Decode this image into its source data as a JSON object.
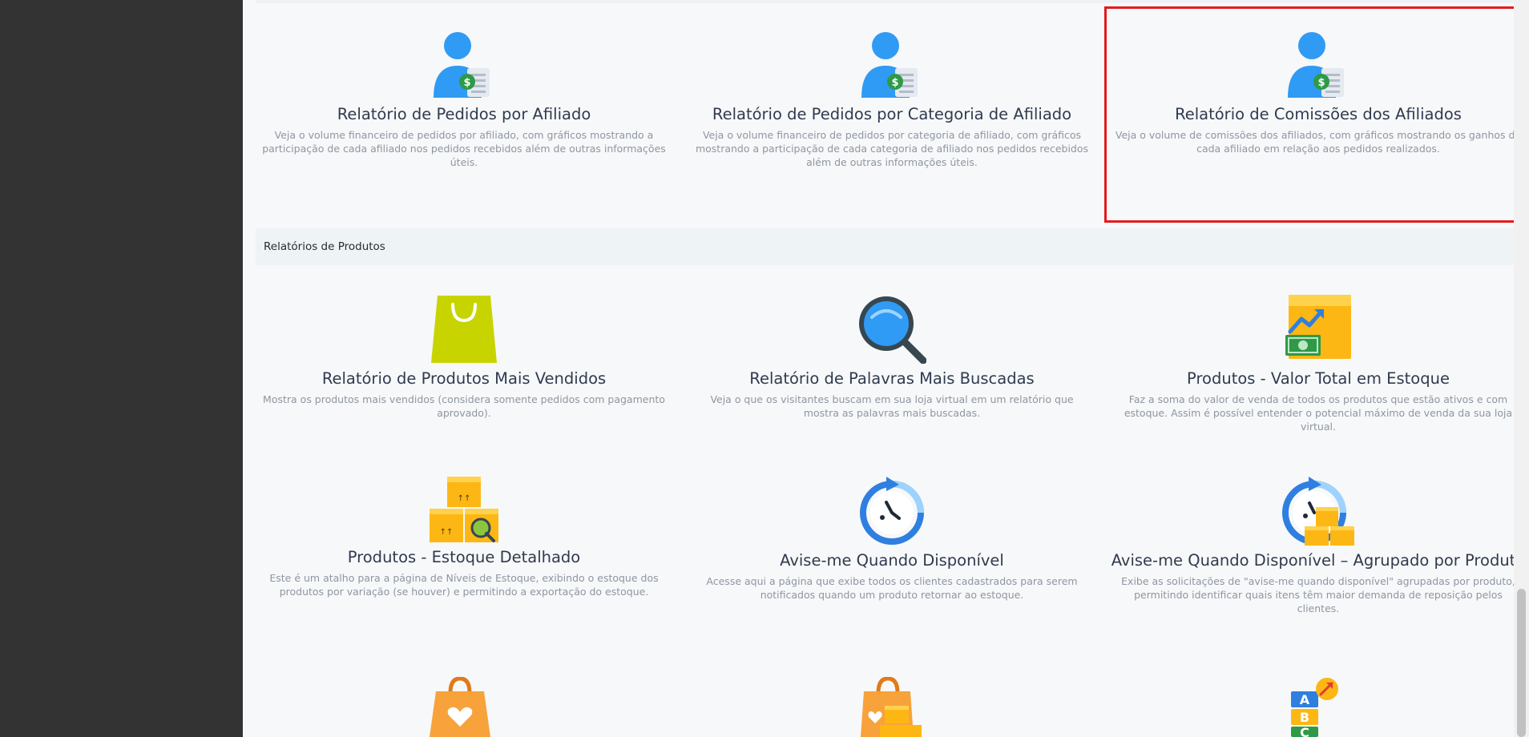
{
  "affiliate_reports": [
    {
      "title": "Relatório de Pedidos por Afiliado",
      "desc": "Veja o volume financeiro de pedidos por afiliado, com gráficos mostrando a participação de cada afiliado nos pedidos recebidos além de outras informações úteis.",
      "icon": "affiliate-money-icon"
    },
    {
      "title": "Relatório de Pedidos por Categoria de Afiliado",
      "desc": "Veja o volume financeiro de pedidos por categoria de afiliado, com gráficos mostrando a participação de cada categoria de afiliado nos pedidos recebidos além de outras informações úteis.",
      "icon": "affiliate-money-icon"
    },
    {
      "title": "Relatório de Comissões dos Afiliados",
      "desc": "Veja o volume de comissões dos afiliados, com gráficos mostrando os ganhos de cada afiliado em relação aos pedidos realizados.",
      "icon": "affiliate-money-icon"
    }
  ],
  "products_section": {
    "label": "Relatórios de Produtos"
  },
  "product_reports": [
    {
      "title": "Relatório de Produtos Mais Vendidos",
      "desc": "Mostra os produtos mais vendidos (considera somente pedidos com pagamento aprovado).",
      "icon": "shopping-bag-icon"
    },
    {
      "title": "Relatório de Palavras Mais Buscadas",
      "desc": "Veja o que os visitantes buscam em sua loja virtual em um relatório que mostra as palavras mais buscadas.",
      "icon": "magnifier-icon"
    },
    {
      "title": "Produtos - Valor Total em Estoque",
      "desc": "Faz a soma do valor de venda de todos os produtos que estão ativos e com estoque. Assim é possível entender o potencial máximo de venda da sua loja virtual.",
      "icon": "stock-value-box-icon"
    },
    {
      "title": "Produtos - Estoque Detalhado",
      "desc": "Este é um atalho para a página de Níveis de Estoque, exibindo o estoque dos produtos por variação (se houver) e permitindo a exportação do estoque.",
      "icon": "boxes-search-icon"
    },
    {
      "title": "Avise-me Quando Disponível",
      "desc": "Acesse aqui a página que exibe todos os clientes cadastrados para serem notificados quando um produto retornar ao estoque.",
      "icon": "clock-refresh-icon"
    },
    {
      "title": "Avise-me Quando Disponível – Agrupado por Produto",
      "desc": "Exibe as solicitações de \"avise-me quando disponível\" agrupadas por produto, permitindo identificar quais itens têm maior demanda de reposição pelos clientes.",
      "icon": "clock-boxes-icon"
    }
  ],
  "bottom_icons": [
    "heart-bag-icon",
    "bag-boxes-icon",
    "abc-trend-icon"
  ],
  "colors": {
    "sidebar": "#333333",
    "highlight": "#e31b1b",
    "accent": "#2f9bf5"
  }
}
